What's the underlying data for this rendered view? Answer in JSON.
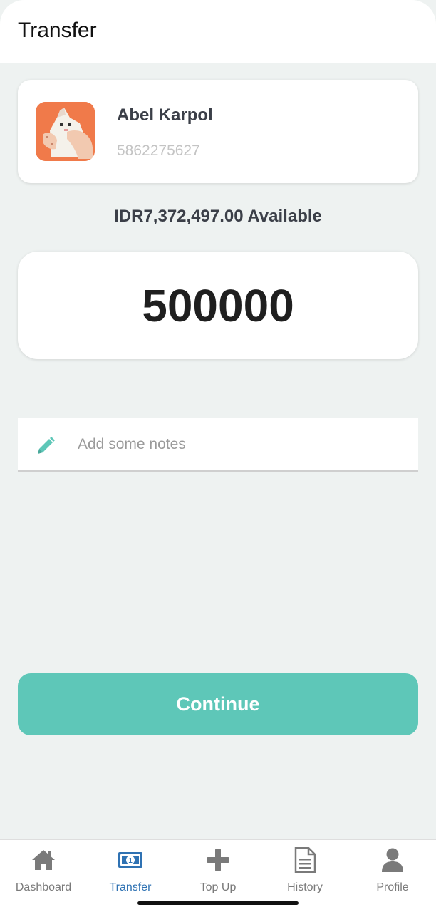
{
  "header": {
    "title": "Transfer"
  },
  "recipient": {
    "name": "Abel Karpol",
    "account_number": "5862275627",
    "avatar_icon": "avatar-cat-image"
  },
  "balance": {
    "text": "IDR7,372,497.00 Available"
  },
  "amount": {
    "value": "500000"
  },
  "notes": {
    "placeholder": "Add some notes",
    "icon": "pencil-icon"
  },
  "actions": {
    "continue_label": "Continue"
  },
  "nav": {
    "items": [
      {
        "label": "Dashboard",
        "icon": "home-icon",
        "active": false
      },
      {
        "label": "Transfer",
        "icon": "money-bill-icon",
        "active": true
      },
      {
        "label": "Top Up",
        "icon": "plus-icon",
        "active": false
      },
      {
        "label": "History",
        "icon": "document-icon",
        "active": false
      },
      {
        "label": "Profile",
        "icon": "user-icon",
        "active": false
      }
    ]
  },
  "colors": {
    "accent": "#5ec7b8",
    "active_nav": "#2f72b3",
    "background": "#eef2f1"
  }
}
